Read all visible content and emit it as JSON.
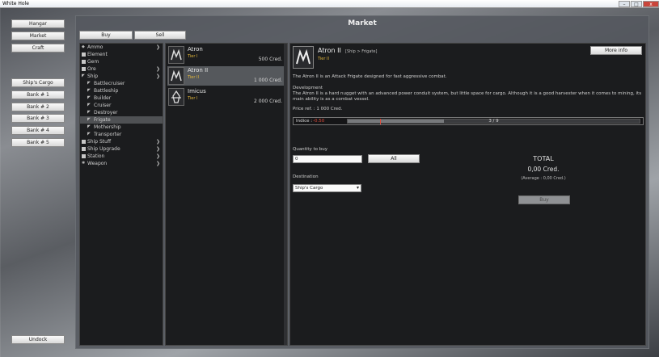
{
  "window": {
    "title": "White Hole",
    "minimize": "–",
    "maximize": "□",
    "close": "x"
  },
  "left_nav": {
    "hangar": "Hangar",
    "market": "Market",
    "craft": "Craft",
    "ships_cargo": "Ship's Cargo",
    "banks": [
      "Bank # 1",
      "Bank # 2",
      "Bank # 3",
      "Bank # 4",
      "Bank # 5"
    ],
    "undock": "Undock"
  },
  "market": {
    "title": "Market",
    "tabs": {
      "buy": "Buy",
      "sell": "Sell"
    },
    "categories": [
      {
        "label": "Ammo",
        "icon": "diamond-icon",
        "chev": "❯"
      },
      {
        "label": "Element",
        "icon": "square-icon"
      },
      {
        "label": "Gem",
        "icon": "square-icon"
      },
      {
        "label": "Ore",
        "icon": "square-icon",
        "chev": "❯"
      },
      {
        "label": "Ship",
        "icon": "ship-icon",
        "chev": "❯"
      },
      {
        "label": "Battlecruiser",
        "icon": "ship-icon"
      },
      {
        "label": "Battleship",
        "icon": "ship-icon"
      },
      {
        "label": "Builder",
        "icon": "ship-icon"
      },
      {
        "label": "Cruiser",
        "icon": "ship-icon"
      },
      {
        "label": "Destroyer",
        "icon": "ship-icon"
      },
      {
        "label": "Frigate",
        "icon": "ship-icon"
      },
      {
        "label": "Mothership",
        "icon": "ship-icon"
      },
      {
        "label": "Transporter",
        "icon": "ship-icon"
      },
      {
        "label": "Ship Stuff",
        "icon": "square-icon",
        "chev": "❯"
      },
      {
        "label": "Ship Upgrade",
        "icon": "square-icon",
        "chev": "❯"
      },
      {
        "label": "Station",
        "icon": "square-icon",
        "chev": "❯"
      },
      {
        "label": "Weapon",
        "icon": "gear-icon",
        "chev": "❯"
      }
    ],
    "ships": [
      {
        "name": "Atron",
        "tier": "Tier I",
        "price": "500 Cred."
      },
      {
        "name": "Atron II",
        "tier": "Tier II",
        "price": "1 000 Cred."
      },
      {
        "name": "Imicus",
        "tier": "Tier I",
        "price": "2 000 Cred."
      }
    ],
    "detail": {
      "name": "Atron II",
      "class": "[Ship > Frigate]",
      "tier": "Tier II",
      "more_info": "More info",
      "summary": "The Atron II is an Attack Frigate designed for fast aggressive combat.",
      "dev_heading": "Development",
      "dev_text": "The Atron II is a hard nugget with an advanced power conduit system, but little space for cargo. Although it is a good harvester when it comes to mining, its main ability is as a combat vessel.",
      "price_ref": "Price ref. :   1 000 Cred.",
      "indice_label": "Indice :",
      "indice_value": "-0.50",
      "indice_count": "3 / 9",
      "indice_fill": 0.33,
      "qty_label": "Quantity to buy",
      "qty_value": "0",
      "all_label": "All",
      "dest_label": "Destination",
      "dest_value": "Ship's Cargo",
      "total_label": "TOTAL",
      "total_value": "0,00 Cred.",
      "total_avg": "(Average : 0,00 Cred.)",
      "buy_label": "Buy"
    }
  }
}
